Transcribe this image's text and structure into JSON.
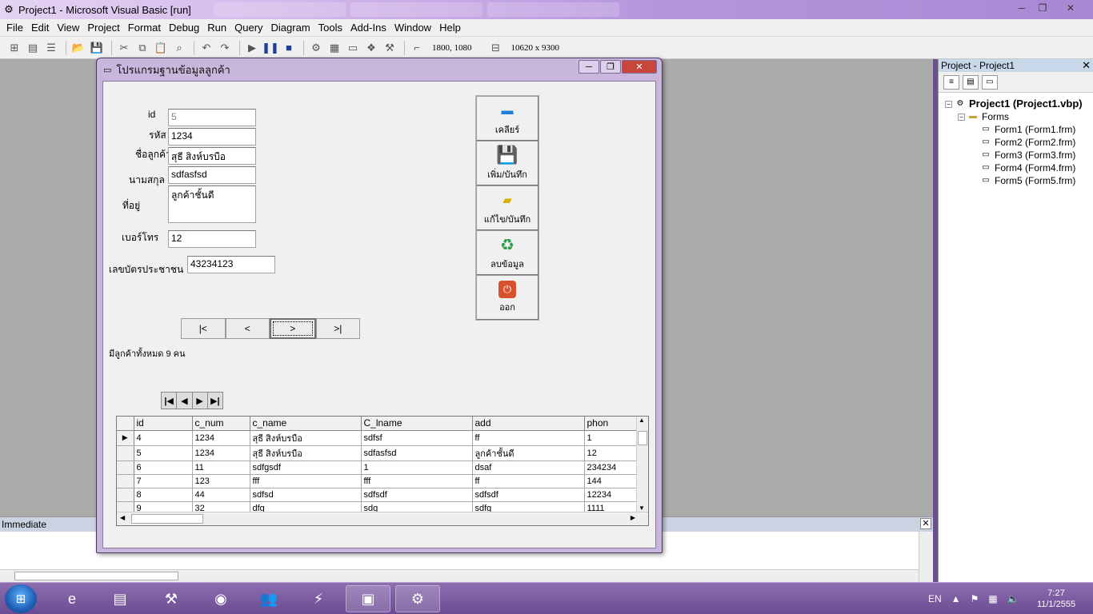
{
  "window": {
    "title": "Project1 - Microsoft Visual Basic [run]",
    "minimize": "─",
    "maximize": "❐",
    "close": "✕"
  },
  "menu": [
    "File",
    "Edit",
    "View",
    "Project",
    "Format",
    "Debug",
    "Run",
    "Query",
    "Diagram",
    "Tools",
    "Add-Ins",
    "Window",
    "Help"
  ],
  "toolbar": {
    "position": "1800, 1080",
    "size": "10620 x 9300"
  },
  "form": {
    "title": "โปรแกรมฐานข้อมูลลูกค้า",
    "fields": {
      "id_label": "id",
      "id_value": "5",
      "code_label": "รหัส",
      "code_value": "1234",
      "name_label": "ชื่อลูกค้า",
      "name_value": "สุธี สิงห์บรบือ",
      "lname_label": "นามสกุล",
      "lname_value": "sdfasfsd",
      "address_label": "ที่อยู่",
      "address_value": "ลูกค้าชั้นดี",
      "phone_label": "เบอร์โทร",
      "phone_value": "12",
      "idcard_label": "เลขบัตรประชาชน",
      "idcard_value": "43234123"
    },
    "buttons": {
      "clear": "เคลียร์",
      "add_save": "เพิ่ม/บันทึก",
      "edit_save": "แก้ไข/บันทึก",
      "delete": "ลบข้อมูล",
      "exit": "ออก"
    },
    "nav": {
      "first": "|<",
      "prev": "<",
      "next": ">",
      "last": ">|"
    },
    "count_text": "มีลูกค้าทั้งหมด 9 คน"
  },
  "grid": {
    "columns": [
      "id",
      "c_num",
      "c_name",
      "C_lname",
      "add",
      "phon"
    ],
    "rows": [
      [
        "4",
        "1234",
        "สุธี สิงห์บรบือ",
        "sdfsf",
        "ff",
        "1"
      ],
      [
        "5",
        "1234",
        "สุธี สิงห์บรบือ",
        "sdfasfsd",
        "ลูกค้าชั้นดี",
        "12"
      ],
      [
        "6",
        "11",
        "sdfgsdf",
        "1",
        "dsaf",
        "234234"
      ],
      [
        "7",
        "123",
        "fff",
        "fff",
        "ff",
        "144"
      ],
      [
        "8",
        "44",
        "sdfsd",
        "sdfsdf",
        "sdfsdf",
        "12234"
      ],
      [
        "9",
        "32",
        "dfg",
        "sdg",
        "sdfg",
        "1111"
      ]
    ],
    "current_row": 0
  },
  "project": {
    "title": "Project - Project1",
    "root": "Project1 (Project1.vbp)",
    "folder": "Forms",
    "items": [
      "Form1 (Form1.frm)",
      "Form2 (Form2.frm)",
      "Form3 (Form3.frm)",
      "Form4 (Form4.frm)",
      "Form5 (Form5.frm)"
    ]
  },
  "immediate": {
    "title": "Immediate"
  },
  "taskbar": {
    "lang": "EN",
    "time": "7:27",
    "date": "11/1/2555"
  },
  "colors": {
    "title_gradient": "#cdb0e8",
    "workspace": "#ababab",
    "taskbar": "#6b4b92"
  }
}
